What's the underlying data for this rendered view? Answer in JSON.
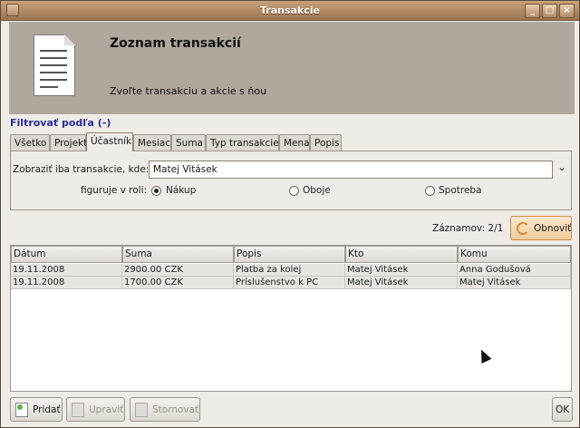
{
  "window": {
    "title": "Transakcie"
  },
  "header": {
    "title": "Zoznam transakcií",
    "subtitle": "Zvoľte transakciu a akcie s ňou"
  },
  "filter": {
    "label": "Filtrovať podľa (-)",
    "tabs": [
      "Všetko",
      "Projekt",
      "Účastník",
      "Mesiac",
      "Suma",
      "Typ transakcie",
      "Mena",
      "Popis"
    ],
    "active_tab": "Účastník",
    "show_label": "Zobraziť iba transakcie, kde:",
    "selected_person": "Matej Vitásek",
    "role_label": "figuruje v roli:",
    "roles": [
      "Nákup",
      "Oboje",
      "Spotreba"
    ],
    "selected_role": "Nákup"
  },
  "records": {
    "label": "Záznamov: 2/1",
    "refresh_label": "Obnoviť"
  },
  "table": {
    "columns": [
      "Dátum",
      "Suma",
      "Popis",
      "Kto",
      "Komu"
    ],
    "rows": [
      [
        "19.11.2008",
        "2900.00 CZK",
        "Platba za kolej",
        "Matej Vitásek",
        "Anna Godušová"
      ],
      [
        "19.11.2008",
        "1700.00 CZK",
        "Príslušenstvo k PC",
        "Matej Vitásek",
        "Matej Vitásek"
      ]
    ]
  },
  "actions": {
    "add": "Pridať",
    "edit": "Upraviť",
    "cancel": "Stornovať",
    "ok": "OK"
  }
}
